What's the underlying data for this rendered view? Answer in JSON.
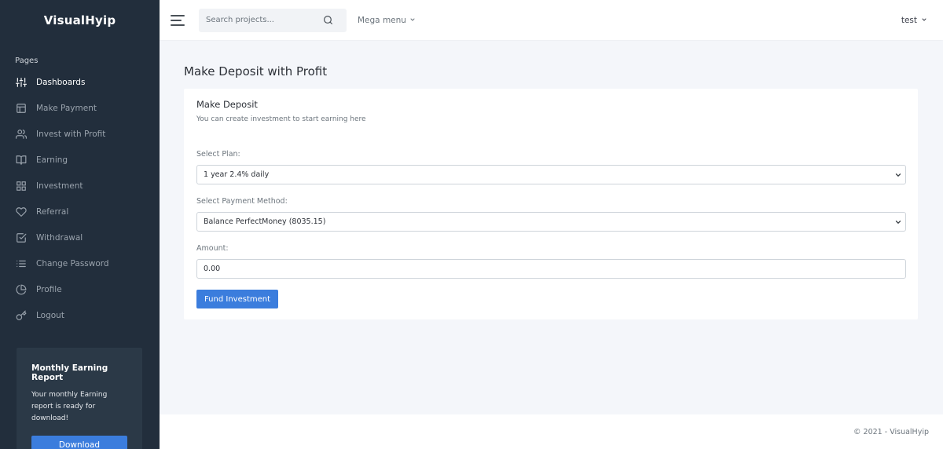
{
  "sidebar": {
    "brand": "VisualHyip",
    "section_header": "Pages",
    "items": [
      {
        "label": "Dashboards",
        "icon": "sliders-icon",
        "active": true
      },
      {
        "label": "Make Payment",
        "icon": "layout-icon",
        "active": false
      },
      {
        "label": "Invest with Profit",
        "icon": "users-icon",
        "active": false
      },
      {
        "label": "Earning",
        "icon": "book-open-icon",
        "active": false
      },
      {
        "label": "Investment",
        "icon": "grid-icon",
        "active": false
      },
      {
        "label": "Referral",
        "icon": "heart-icon",
        "active": false
      },
      {
        "label": "Withdrawal",
        "icon": "check-square-icon",
        "active": false
      },
      {
        "label": "Change Password",
        "icon": "list-icon",
        "active": false
      },
      {
        "label": "Profile",
        "icon": "pie-chart-icon",
        "active": false
      },
      {
        "label": "Logout",
        "icon": "key-icon",
        "active": false
      }
    ],
    "cta": {
      "title": "Monthly Earning Report",
      "text": "Your monthly Earning report is ready for download!",
      "button_label": "Download"
    }
  },
  "topbar": {
    "search_placeholder": "Search projects...",
    "mega_menu_label": "Mega menu",
    "user_name": "test"
  },
  "main": {
    "page_title": "Make Deposit with Profit",
    "card": {
      "title": "Make Deposit",
      "subtitle": "You can create investment to start earning here",
      "plan_label": "Select Plan:",
      "plan_value": "1 year 2.4% daily",
      "payment_label": "Select Payment Method:",
      "payment_value": "Balance PerfectMoney (8035.15)",
      "amount_label": "Amount:",
      "amount_value": "0.00",
      "submit_label": "Fund Investment"
    }
  },
  "footer": {
    "copyright": "© 2021 - VisualHyip"
  },
  "colors": {
    "sidebar_bg": "#222e3c",
    "primary": "#3b7ddd",
    "page_bg": "#f4f6fa"
  }
}
